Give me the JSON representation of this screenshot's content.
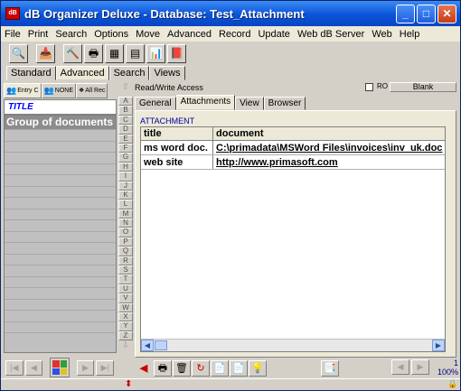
{
  "window": {
    "title": "dB Organizer Deluxe - Database: Test_Attachment",
    "app_icon": "dB"
  },
  "window_buttons": {
    "minimize": "_",
    "maximize": "□",
    "close": "✕"
  },
  "menu": [
    "File",
    "Print",
    "Search",
    "Options",
    "Move",
    "Advanced",
    "Record",
    "Update",
    "Web dB Server",
    "Web",
    "Help"
  ],
  "toolbar_icons": [
    "search-icon",
    "import-icon",
    "tools-icon",
    "print-icon",
    "table-icon",
    "form-icon",
    "chart-icon",
    "book-icon"
  ],
  "mode_tabs": [
    "Standard",
    "Advanced",
    "Search",
    "Views"
  ],
  "left_tabs": [
    {
      "label": "Entry C"
    },
    {
      "label": "NONE"
    },
    {
      "label": "All Rec"
    }
  ],
  "list": {
    "header": "TITLE",
    "items": [
      "Group of documents"
    ]
  },
  "alphabet": [
    "A",
    "B",
    "C",
    "D",
    "E",
    "F",
    "G",
    "H",
    "I",
    "J",
    "K",
    "L",
    "M",
    "N",
    "O",
    "P",
    "Q",
    "R",
    "S",
    "T",
    "U",
    "V",
    "W",
    "X",
    "Y",
    "Z"
  ],
  "access": {
    "label": "Read/Write Access",
    "ro_label": "RO",
    "blank_button": "Blank"
  },
  "record_tabs": [
    "General",
    "Attachments",
    "View",
    "Browser"
  ],
  "attachment": {
    "section_label": "ATTACHMENT",
    "columns": [
      "title",
      "document"
    ],
    "rows": [
      {
        "title": "ms word doc.",
        "document": "C:\\primadata\\MSWord Files\\invoices\\inv_uk.doc"
      },
      {
        "title": "web site",
        "document": "http://www.primasoft.com"
      }
    ]
  },
  "pager": {
    "page": "1",
    "zoom": "100%"
  }
}
